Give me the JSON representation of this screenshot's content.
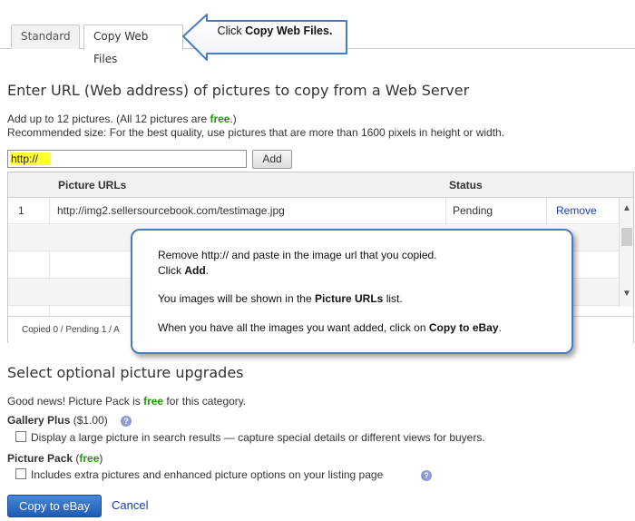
{
  "tabs": [
    {
      "label": "Standard",
      "active": false
    },
    {
      "label": "Copy Web Files",
      "active": true
    }
  ],
  "callout_top": {
    "prefix": "Click ",
    "bold": "Copy Web Files."
  },
  "url_section": {
    "heading": "Enter URL (Web address) of pictures to copy from a Web Server",
    "limit_prefix": "Add up to 12 pictures. (All 12 pictures are ",
    "limit_free": "free",
    "limit_suffix": ".)",
    "recommended": "Recommended size: For the best quality, use pictures that are more than 1600 pixels in height or width.",
    "input_value": "http://",
    "add_label": "Add"
  },
  "grid": {
    "col_url": "Picture URLs",
    "col_status": "Status",
    "rows": [
      {
        "num": "1",
        "url": "http://img2.sellersourcebook.com/testimage.jpg",
        "status": "Pending",
        "action": "Remove"
      }
    ],
    "footer": "Copied 0 / Pending 1 / A"
  },
  "callout_note": {
    "line1": "Remove http:// and paste in the image url that you copied.",
    "line2_prefix": "Click ",
    "line2_bold": "Add",
    "line2_suffix": ".",
    "line3_prefix": "You images will be shown in the ",
    "line3_bold": "Picture URLs",
    "line3_suffix": " list.",
    "line4_prefix": "When you have all the images you want added, click on ",
    "line4_bold": "Copy to eBay",
    "line4_suffix": "."
  },
  "upgrades": {
    "heading": "Select optional picture upgrades",
    "good_news_prefix": "Good news! Picture Pack is ",
    "good_news_free": "free",
    "good_news_suffix": " for this category.",
    "gallery_title": "Gallery Plus",
    "gallery_price": "($1.00)",
    "gallery_desc": "Display a large picture in search results — capture special details or different views for buyers.",
    "pack_title": "Picture Pack",
    "pack_open": "(",
    "pack_free": "free",
    "pack_close": ")",
    "pack_desc": "Includes extra pictures and enhanced picture options on your listing page",
    "help_glyph": "?"
  },
  "actions": {
    "copy_label": "Copy to eBay",
    "cancel_label": "Cancel"
  },
  "colors": {
    "free": "#1a9b00",
    "link": "#1a3cb8",
    "callout_border": "#4a7cc0",
    "highlight": "#ffff33"
  }
}
